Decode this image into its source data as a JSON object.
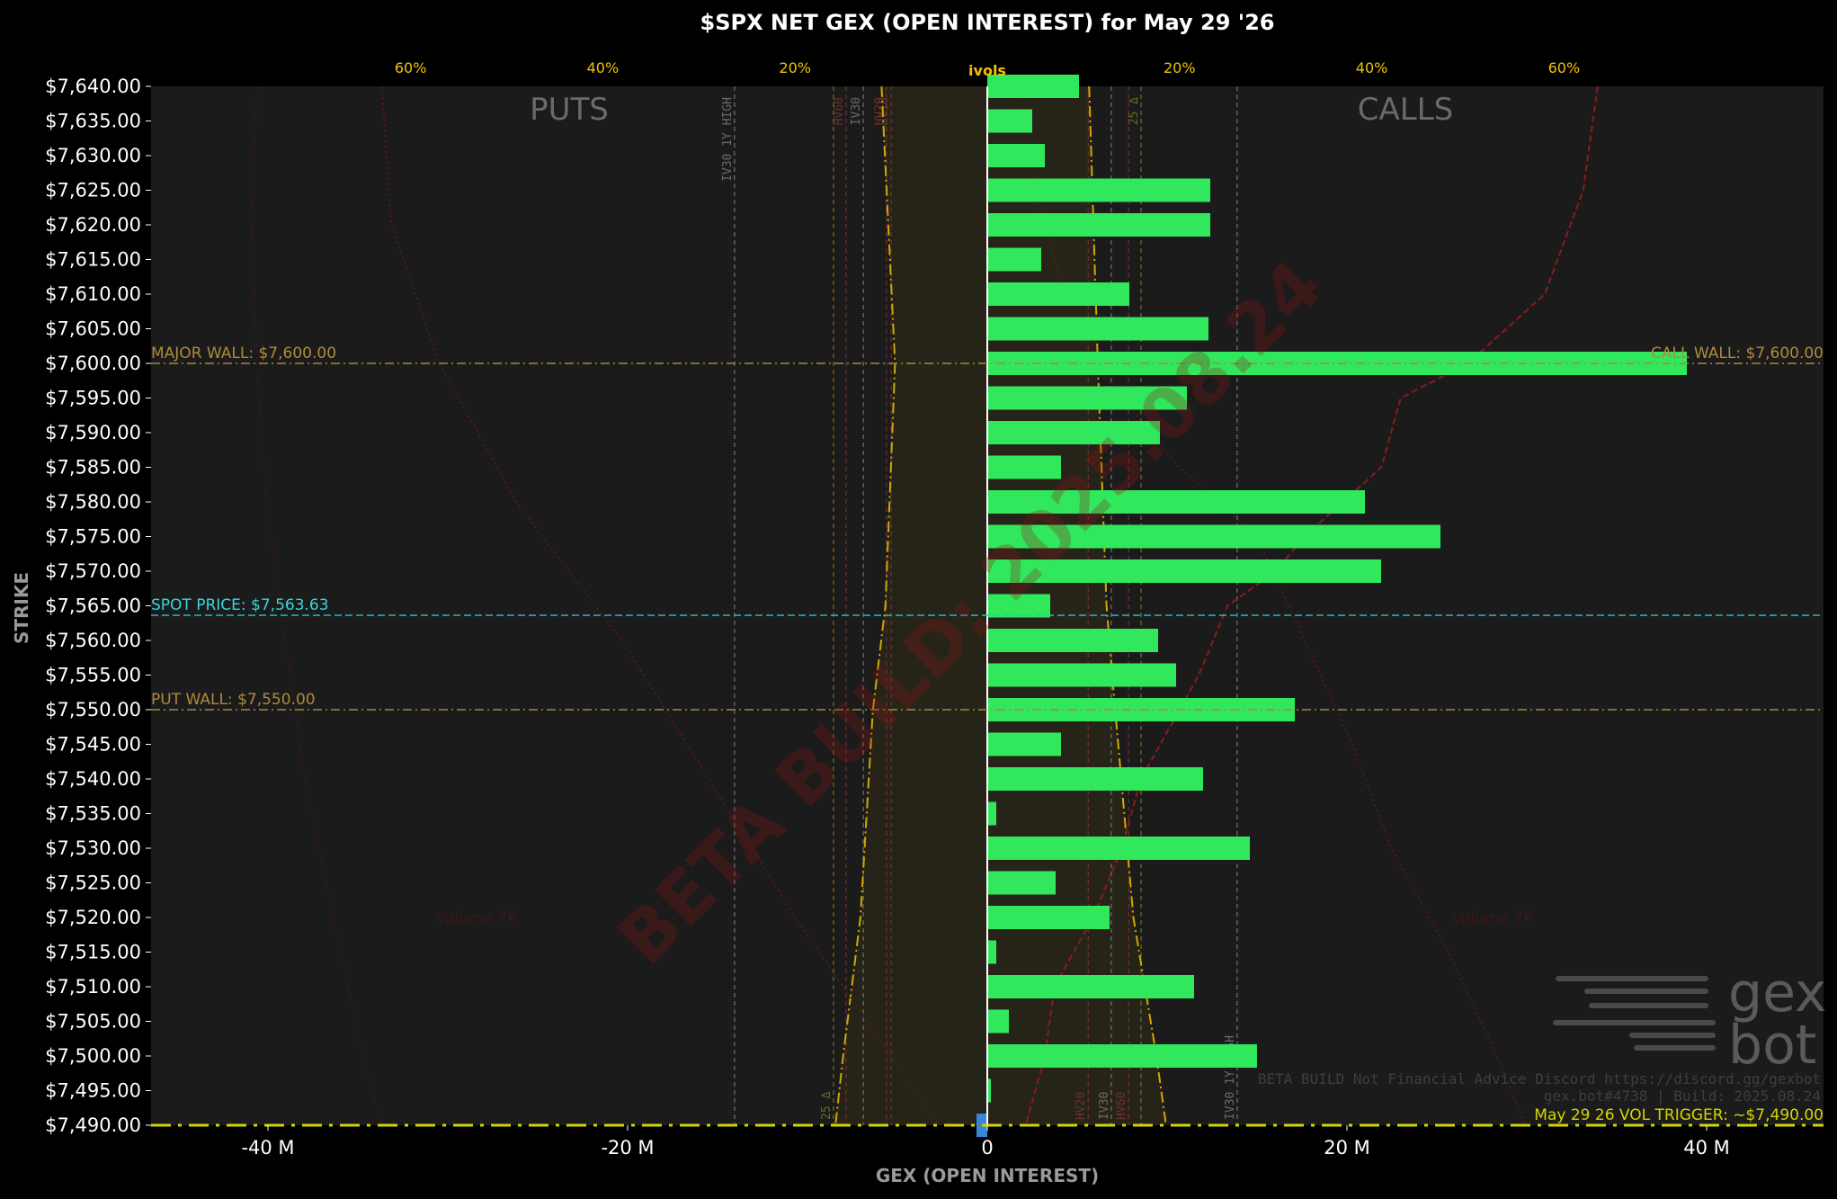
{
  "title": "$SPX NET GEX (OPEN INTEREST) for May 29 '26",
  "chart_data": {
    "type": "bar",
    "orientation": "horizontal",
    "title": "$SPX NET GEX (OPEN INTEREST) for May 29 '26",
    "xlabel": "GEX (OPEN INTEREST)",
    "ylabel": "STRIKE",
    "xlim": [
      -46.5,
      46.5
    ],
    "ylim": [
      7490,
      7640
    ],
    "x_ticks": [
      "-40 M",
      "-20 M",
      "0",
      "20 M",
      "40 M"
    ],
    "x_tick_values": [
      -40,
      -20,
      0,
      20,
      40
    ],
    "top_axis_label": "ivols",
    "top_ticks": [
      "60%",
      "40%",
      "20%",
      "20%",
      "40%",
      "60%"
    ],
    "top_tick_values": [
      -60,
      -40,
      -20,
      20,
      40,
      60
    ],
    "top_xlim": [
      -87,
      87
    ],
    "categories": [
      "$7,640.00",
      "$7,635.00",
      "$7,630.00",
      "$7,625.00",
      "$7,620.00",
      "$7,615.00",
      "$7,610.00",
      "$7,605.00",
      "$7,600.00",
      "$7,595.00",
      "$7,590.00",
      "$7,585.00",
      "$7,580.00",
      "$7,575.00",
      "$7,570.00",
      "$7,565.00",
      "$7,560.00",
      "$7,555.00",
      "$7,550.00",
      "$7,545.00",
      "$7,540.00",
      "$7,535.00",
      "$7,530.00",
      "$7,525.00",
      "$7,520.00",
      "$7,515.00",
      "$7,510.00",
      "$7,505.00",
      "$7,500.00",
      "$7,495.00",
      "$7,490.00"
    ],
    "strikes": [
      7640,
      7635,
      7630,
      7625,
      7620,
      7615,
      7610,
      7605,
      7600,
      7595,
      7590,
      7585,
      7580,
      7575,
      7570,
      7565,
      7560,
      7555,
      7550,
      7545,
      7540,
      7535,
      7530,
      7525,
      7520,
      7515,
      7510,
      7505,
      7500,
      7495,
      7490
    ],
    "series": [
      {
        "values": [
          5.1,
          2.5,
          3.2,
          12.4,
          12.4,
          3.0,
          7.9,
          12.3,
          38.9,
          11.1,
          9.6,
          4.1,
          21.0,
          25.2,
          21.9,
          3.5,
          9.5,
          10.5,
          17.1,
          4.1,
          12.0,
          0.5,
          14.6,
          3.8,
          6.8,
          0.5,
          11.5,
          1.2,
          15.0,
          0.2,
          -0.6
        ],
        "colors": [
          "#31e85d",
          "#31e85d",
          "#31e85d",
          "#31e85d",
          "#31e85d",
          "#31e85d",
          "#31e85d",
          "#31e85d",
          "#31e85d",
          "#31e85d",
          "#31e85d",
          "#31e85d",
          "#31e85d",
          "#31e85d",
          "#31e85d",
          "#31e85d",
          "#31e85d",
          "#31e85d",
          "#31e85d",
          "#31e85d",
          "#31e85d",
          "#31e85d",
          "#31e85d",
          "#31e85d",
          "#31e85d",
          "#31e85d",
          "#31e85d",
          "#31e85d",
          "#31e85d",
          "#31e85d",
          "#3a86d6"
        ]
      }
    ],
    "reference_lines": [
      {
        "strike": 7600,
        "left_label": "MAJOR WALL: $7,600.00",
        "right_label": "CALL WALL: $7,600.00",
        "color": "#a9863b"
      },
      {
        "strike": 7563.63,
        "left_label": "SPOT PRICE: $7,563.63",
        "color": "#27c6cc"
      },
      {
        "strike": 7550,
        "left_label": "PUT WALL: $7,550.00",
        "color": "#a9863b"
      },
      {
        "strike": 7490,
        "right_label": "May 29 26 VOL TRIGGER: ~$7,490.00",
        "color": "#d4d400"
      }
    ],
    "vertical_markers": [
      {
        "label": "IV30 1Y HIGH",
        "ivol": -26.3,
        "color": "#6b6b6b",
        "label_pos": "top"
      },
      {
        "label": "HV60",
        "ivol": -14.7,
        "color": "#6b3030",
        "label_pos": "top"
      },
      {
        "label": "IV30",
        "ivol": -12.9,
        "color": "#6b6b6b",
        "label_pos": "top"
      },
      {
        "label": "HV20",
        "ivol": -10.5,
        "color": "#6b3030",
        "label_pos": "top"
      },
      {
        "label": "HV10",
        "ivol": -10.0,
        "color": "#6b3030",
        "label_pos": "top"
      },
      {
        "label": "25 Δ",
        "ivol": 16.0,
        "color": "#6b6a20",
        "label_pos": "top"
      },
      {
        "label": "25 Δ",
        "ivol": -16.0,
        "color": "#6b6a20",
        "label_pos": "bottom"
      },
      {
        "label": "HV20",
        "ivol": 10.5,
        "color": "#6b3030",
        "label_pos": "bottom"
      },
      {
        "label": "IV30",
        "ivol": 12.9,
        "color": "#6b6b6b",
        "label_pos": "bottom"
      },
      {
        "label": "HV60",
        "ivol": 14.7,
        "color": "#6b3030",
        "label_pos": "bottom"
      },
      {
        "label": "IV30 1Y HIGH",
        "ivol": 26.0,
        "color": "#6b6b6b",
        "label_pos": "bottom"
      }
    ],
    "ivol_curves": {
      "put_side_dashdot": [
        [
          7640,
          -11
        ],
        [
          7600,
          -9.6
        ],
        [
          7565,
          -10.6
        ],
        [
          7550,
          -11.9
        ],
        [
          7520,
          -13.2
        ],
        [
          7500,
          -15.0
        ],
        [
          7490,
          -15.8
        ]
      ],
      "call_side_dashdot": [
        [
          7640,
          10.6
        ],
        [
          7600,
          11.5
        ],
        [
          7565,
          12.4
        ],
        [
          7550,
          13.3
        ],
        [
          7520,
          15.2
        ],
        [
          7500,
          17.6
        ],
        [
          7490,
          18.6
        ]
      ],
      "call_skew_dashed": [
        [
          7640,
          63.5
        ],
        [
          7625,
          62
        ],
        [
          7610,
          58
        ],
        [
          7600,
          50
        ],
        [
          7595,
          43
        ],
        [
          7585,
          41
        ],
        [
          7575,
          33
        ],
        [
          7570,
          30
        ],
        [
          7565,
          25
        ],
        [
          7555,
          22
        ],
        [
          7550,
          20
        ],
        [
          7540,
          16
        ],
        [
          7530,
          14
        ],
        [
          7520,
          11
        ],
        [
          7510,
          7
        ],
        [
          7500,
          6
        ],
        [
          7490,
          4
        ]
      ],
      "call_upper_dotted": [
        [
          7640,
          3
        ],
        [
          7625,
          5
        ],
        [
          7610,
          8
        ],
        [
          7600,
          11
        ],
        [
          7585,
          20
        ],
        [
          7575,
          28
        ],
        [
          7560,
          33
        ],
        [
          7545,
          38
        ],
        [
          7530,
          42
        ],
        [
          7515,
          48
        ],
        [
          7500,
          53
        ],
        [
          7490,
          56
        ]
      ],
      "put_outer_dotted": [
        [
          7640,
          -63
        ],
        [
          7620,
          -62
        ],
        [
          7600,
          -57
        ],
        [
          7580,
          -49
        ],
        [
          7560,
          -38
        ],
        [
          7540,
          -29
        ],
        [
          7520,
          -20
        ],
        [
          7500,
          -10
        ],
        [
          7490,
          -5
        ]
      ]
    },
    "region_labels": {
      "left": "PUTS",
      "right": "CALLS"
    },
    "grid": false
  },
  "watermark": "BETA BUILD: 2025.08.24",
  "brand": {
    "line1": "gex",
    "line2": "bot"
  },
  "footer": {
    "line1": "BETA BUILD Not Financial Advice Discord https://discord.gg/gexbot",
    "line2": "gex.bot#4738 | Build: 2025.08.24"
  },
  "faint_labels": {
    "left": "Volume 7K",
    "right": "Volume 7K"
  },
  "colors": {
    "background": "#000000",
    "plot_background": "#1b1b1b",
    "call_bar": "#31e85d",
    "negative_bar": "#3a86d6",
    "ivol_curve": "#d4a800",
    "skew_curve": "#8a1c1c",
    "zero_line": "#ffffff"
  }
}
